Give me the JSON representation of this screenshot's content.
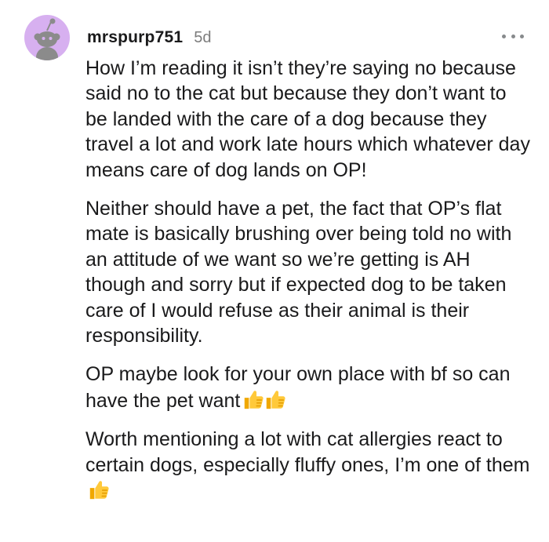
{
  "comment": {
    "username": "mrspurp751",
    "age": "5d",
    "avatar_color": "#d7b0f0",
    "more_icon": "ellipsis-icon",
    "paragraphs": [
      "How I’m reading it isn’t they’re saying no because said no to the cat but because they don’t want to be landed with the care of a dog because they travel a lot and work late hours which whatever day means care of dog lands on OP!",
      "Neither should have a pet, the fact that OP’s flat mate is basically brushing over being told no with an attitude of we want so we’re getting is AH though and sorry but if expected dog to be taken care of I would refuse as their animal is their responsibility.",
      "OP maybe look for your own place with bf so can have the pet want",
      "Worth mentioning a lot with cat allergies react to certain dogs, especially fluffy ones, I’m one of them"
    ],
    "emoji": {
      "p3": [
        "thumbs-up-icon",
        "thumbs-up-icon"
      ],
      "p4": [
        "thumbs-up-icon"
      ],
      "color": "#f7b500"
    }
  }
}
